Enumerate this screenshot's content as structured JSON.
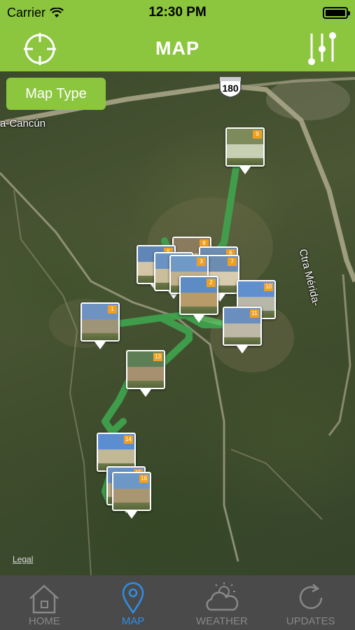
{
  "status": {
    "carrier": "Carrier",
    "time": "12:30 PM",
    "battery_level": 1.0
  },
  "nav": {
    "title": "MAP"
  },
  "map": {
    "map_type_label": "Map Type",
    "road_labels": {
      "left": "a-Cancún",
      "right": "Ctra Mérida-"
    },
    "highway_number": "180",
    "legal": "Legal"
  },
  "markers": [
    {
      "id": "marker-9",
      "num": "9"
    },
    {
      "id": "marker-8",
      "num": "8"
    },
    {
      "id": "marker-6",
      "num": "6"
    },
    {
      "id": "marker-7",
      "num": "7"
    },
    {
      "id": "marker-5",
      "num": "5"
    },
    {
      "id": "marker-4",
      "num": "4"
    },
    {
      "id": "marker-3",
      "num": "3"
    },
    {
      "id": "marker-2",
      "num": "2"
    },
    {
      "id": "marker-10",
      "num": "10"
    },
    {
      "id": "marker-1",
      "num": "1"
    },
    {
      "id": "marker-11",
      "num": "11"
    },
    {
      "id": "marker-13",
      "num": "13"
    },
    {
      "id": "marker-14",
      "num": "14"
    },
    {
      "id": "marker-15",
      "num": "15"
    },
    {
      "id": "marker-16",
      "num": "16"
    }
  ],
  "tabs": [
    {
      "label": "HOME",
      "icon": "house-icon",
      "active": false
    },
    {
      "label": "MAP",
      "icon": "map-pin-icon",
      "active": true
    },
    {
      "label": "WEATHER",
      "icon": "cloud-sun-icon",
      "active": false
    },
    {
      "label": "UPDATES",
      "icon": "refresh-icon",
      "active": false
    }
  ],
  "colors": {
    "accent": "#8cc63f",
    "route": "#3fa34d",
    "tab_active": "#2f8fe6",
    "tab_inactive": "#888888",
    "tab_bar": "#4a4a4a",
    "badge": "#f0a020"
  }
}
